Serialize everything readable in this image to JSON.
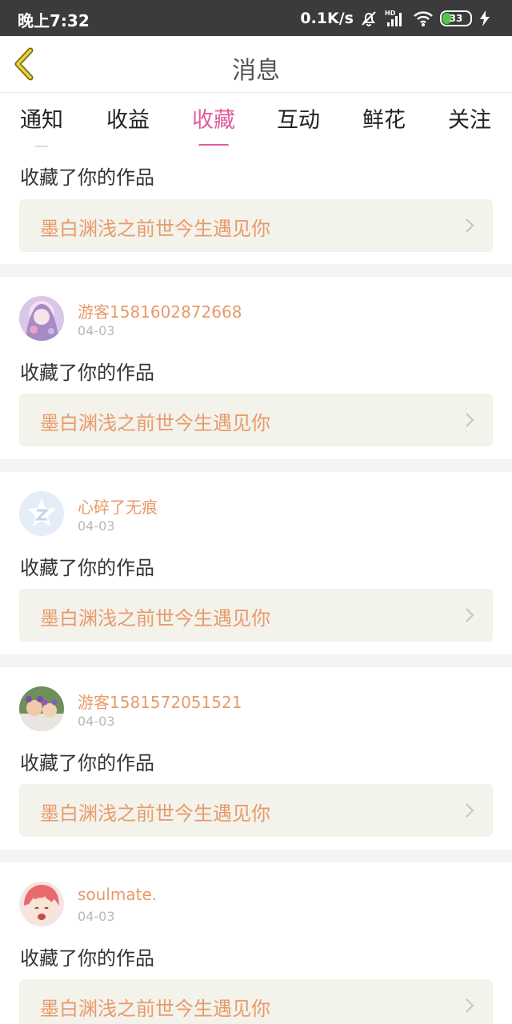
{
  "status_bar": {
    "time": "晚上7:32",
    "net_speed": "0.1K/s",
    "battery": "33"
  },
  "header": {
    "title": "消息"
  },
  "tabs": [
    {
      "label": "通知",
      "active": false
    },
    {
      "label": "收益",
      "active": false
    },
    {
      "label": "收藏",
      "active": true
    },
    {
      "label": "互动",
      "active": false
    },
    {
      "label": "鲜花",
      "active": false
    },
    {
      "label": "关注",
      "active": false
    }
  ],
  "colors": {
    "accent": "#e05da0",
    "name": "#e89a6a",
    "work_bg": "#f3f3eb"
  },
  "messages": [
    {
      "user": "",
      "date": "",
      "action": "收藏了你的作品",
      "work_title": "墨白渊浅之前世今生遇见你"
    },
    {
      "user": "游客1581602872668",
      "date": "04-03",
      "action": "收藏了你的作品",
      "work_title": "墨白渊浅之前世今生遇见你",
      "avatar": "anime-girl-avatar"
    },
    {
      "user": "心碎了无痕",
      "date": "04-03",
      "action": "收藏了你的作品",
      "work_title": "墨白渊浅之前世今生遇见你",
      "avatar": "qzone-default-avatar"
    },
    {
      "user": "游客1581572051521",
      "date": "04-03",
      "action": "收藏了你的作品",
      "work_title": "墨白渊浅之前世今生遇见你",
      "avatar": "photo-avatar"
    },
    {
      "user": "soulmate.",
      "date": "04-03",
      "action": "收藏了你的作品",
      "work_title": "墨白渊浅之前世今生遇见你",
      "avatar": "cartoon-avatar"
    }
  ]
}
